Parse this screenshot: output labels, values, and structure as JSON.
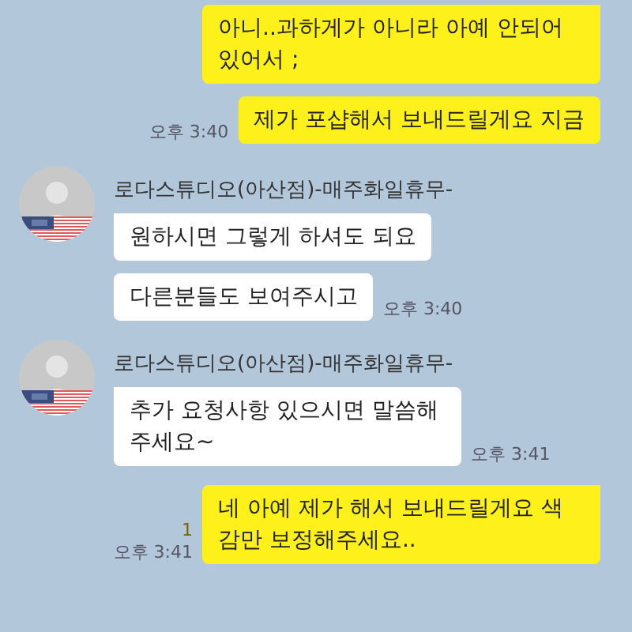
{
  "messages": [
    {
      "kind": "sent",
      "bubbles": [
        {
          "text": "아니..과하게가 아니라 아예 안되어 있어서 ;"
        },
        {
          "text": "제가 포샵해서 보내드릴게요 지금",
          "time": "오후 3:40"
        }
      ]
    },
    {
      "kind": "received",
      "sender": "로다스튜디오(아산점)-매주화일휴무-",
      "bubbles": [
        {
          "text": "원하시면 그렇게 하셔도 되요"
        },
        {
          "text": "다른분들도 보여주시고",
          "time": "오후 3:40"
        }
      ]
    },
    {
      "kind": "received",
      "sender": "로다스튜디오(아산점)-매주화일휴무-",
      "bubbles": [
        {
          "text": "추가 요청사항 있으시면 말씀해주세요~",
          "time": "오후 3:41"
        }
      ]
    },
    {
      "kind": "sent",
      "bubbles": [
        {
          "text": "네 아예 제가 해서 보내드릴게요 색감만 보정해주세요..",
          "time": "오후 3:41",
          "unread": "1"
        }
      ]
    }
  ]
}
